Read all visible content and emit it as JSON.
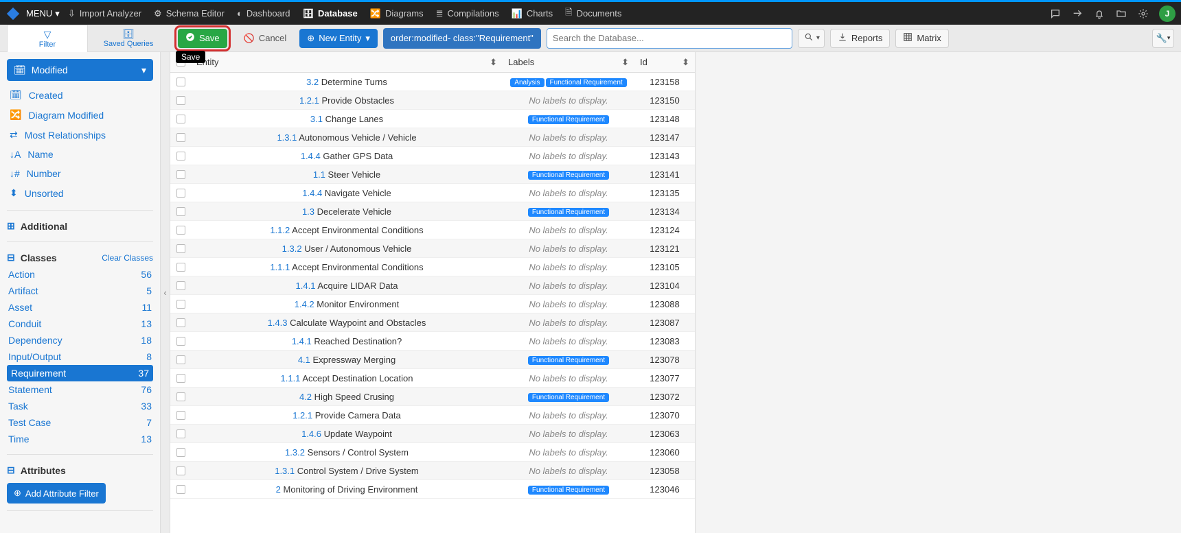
{
  "topbar": {
    "menu": "MENU",
    "items": [
      {
        "label": "Import Analyzer",
        "icon": "download-icon"
      },
      {
        "label": "Schema Editor",
        "icon": "gear-icon"
      },
      {
        "label": "Dashboard",
        "icon": "gauge-icon"
      },
      {
        "label": "Database",
        "icon": "database-icon",
        "active": true
      },
      {
        "label": "Diagrams",
        "icon": "diagram-icon"
      },
      {
        "label": "Compilations",
        "icon": "layers-icon"
      },
      {
        "label": "Charts",
        "icon": "chart-icon"
      },
      {
        "label": "Documents",
        "icon": "document-icon"
      }
    ],
    "avatar_letter": "J"
  },
  "subtabs": {
    "filter": "Filter",
    "saved": "Saved Queries"
  },
  "actions": {
    "save": "Save",
    "cancel": "Cancel",
    "new_entity": "New Entity",
    "query": "order:modified- class:\"Requirement\"",
    "search_placeholder": "Search the Database...",
    "reports": "Reports",
    "matrix": "Matrix"
  },
  "tooltip": "Save",
  "sidebar": {
    "modified": "Modified",
    "created": "Created",
    "diagram_modified": "Diagram Modified",
    "most_rel": "Most Relationships",
    "name": "Name",
    "number": "Number",
    "unsorted": "Unsorted",
    "additional": "Additional",
    "classes_head": "Classes",
    "clear_classes": "Clear Classes",
    "classes": [
      {
        "name": "Action",
        "count": "56"
      },
      {
        "name": "Artifact",
        "count": "5"
      },
      {
        "name": "Asset",
        "count": "11"
      },
      {
        "name": "Conduit",
        "count": "13"
      },
      {
        "name": "Dependency",
        "count": "18"
      },
      {
        "name": "Input/Output",
        "count": "8"
      },
      {
        "name": "Requirement",
        "count": "37",
        "active": true
      },
      {
        "name": "Statement",
        "count": "76"
      },
      {
        "name": "Task",
        "count": "33"
      },
      {
        "name": "Test Case",
        "count": "7"
      },
      {
        "name": "Time",
        "count": "13"
      }
    ],
    "attributes_head": "Attributes",
    "add_attr": "Add Attribute Filter"
  },
  "table": {
    "headers": {
      "entity": "Entity",
      "labels": "Labels",
      "id": "Id"
    },
    "no_labels": "No labels to display.",
    "rows": [
      {
        "num": "3.2",
        "name": "Determine Turns",
        "labels": [
          "Analysis",
          "Functional Requirement"
        ],
        "id": "123158"
      },
      {
        "num": "1.2.1",
        "name": "Provide Obstacles",
        "labels": [],
        "id": "123150"
      },
      {
        "num": "3.1",
        "name": "Change Lanes",
        "labels": [
          "Functional Requirement"
        ],
        "id": "123148"
      },
      {
        "num": "1.3.1",
        "name": "Autonomous Vehicle / Vehicle",
        "labels": [],
        "id": "123147"
      },
      {
        "num": "1.4.4",
        "name": "Gather GPS Data",
        "labels": [],
        "id": "123143"
      },
      {
        "num": "1.1",
        "name": "Steer Vehicle",
        "labels": [
          "Functional Requirement"
        ],
        "id": "123141"
      },
      {
        "num": "1.4.4",
        "name": "Navigate Vehicle",
        "labels": [],
        "id": "123135"
      },
      {
        "num": "1.3",
        "name": "Decelerate Vehicle",
        "labels": [
          "Functional Requirement"
        ],
        "id": "123134"
      },
      {
        "num": "1.1.2",
        "name": "Accept Environmental Conditions",
        "labels": [],
        "id": "123124"
      },
      {
        "num": "1.3.2",
        "name": "User / Autonomous Vehicle",
        "labels": [],
        "id": "123121"
      },
      {
        "num": "1.1.1",
        "name": "Accept Environmental Conditions",
        "labels": [],
        "id": "123105"
      },
      {
        "num": "1.4.1",
        "name": "Acquire LIDAR Data",
        "labels": [],
        "id": "123104"
      },
      {
        "num": "1.4.2",
        "name": "Monitor Environment",
        "labels": [],
        "id": "123088"
      },
      {
        "num": "1.4.3",
        "name": "Calculate Waypoint and Obstacles",
        "labels": [],
        "id": "123087"
      },
      {
        "num": "1.4.1",
        "name": "Reached Destination?",
        "labels": [],
        "id": "123083"
      },
      {
        "num": "4.1",
        "name": "Expressway Merging",
        "labels": [
          "Functional Requirement"
        ],
        "id": "123078"
      },
      {
        "num": "1.1.1",
        "name": "Accept Destination Location",
        "labels": [],
        "id": "123077"
      },
      {
        "num": "4.2",
        "name": "High Speed Crusing",
        "labels": [
          "Functional Requirement"
        ],
        "id": "123072"
      },
      {
        "num": "1.2.1",
        "name": "Provide Camera Data",
        "labels": [],
        "id": "123070"
      },
      {
        "num": "1.4.6",
        "name": "Update Waypoint",
        "labels": [],
        "id": "123063"
      },
      {
        "num": "1.3.2",
        "name": "Sensors / Control System",
        "labels": [],
        "id": "123060"
      },
      {
        "num": "1.3.1",
        "name": "Control System / Drive System",
        "labels": [],
        "id": "123058"
      },
      {
        "num": "2",
        "name": "Monitoring of Driving Environment",
        "labels": [
          "Functional Requirement"
        ],
        "id": "123046"
      }
    ]
  }
}
